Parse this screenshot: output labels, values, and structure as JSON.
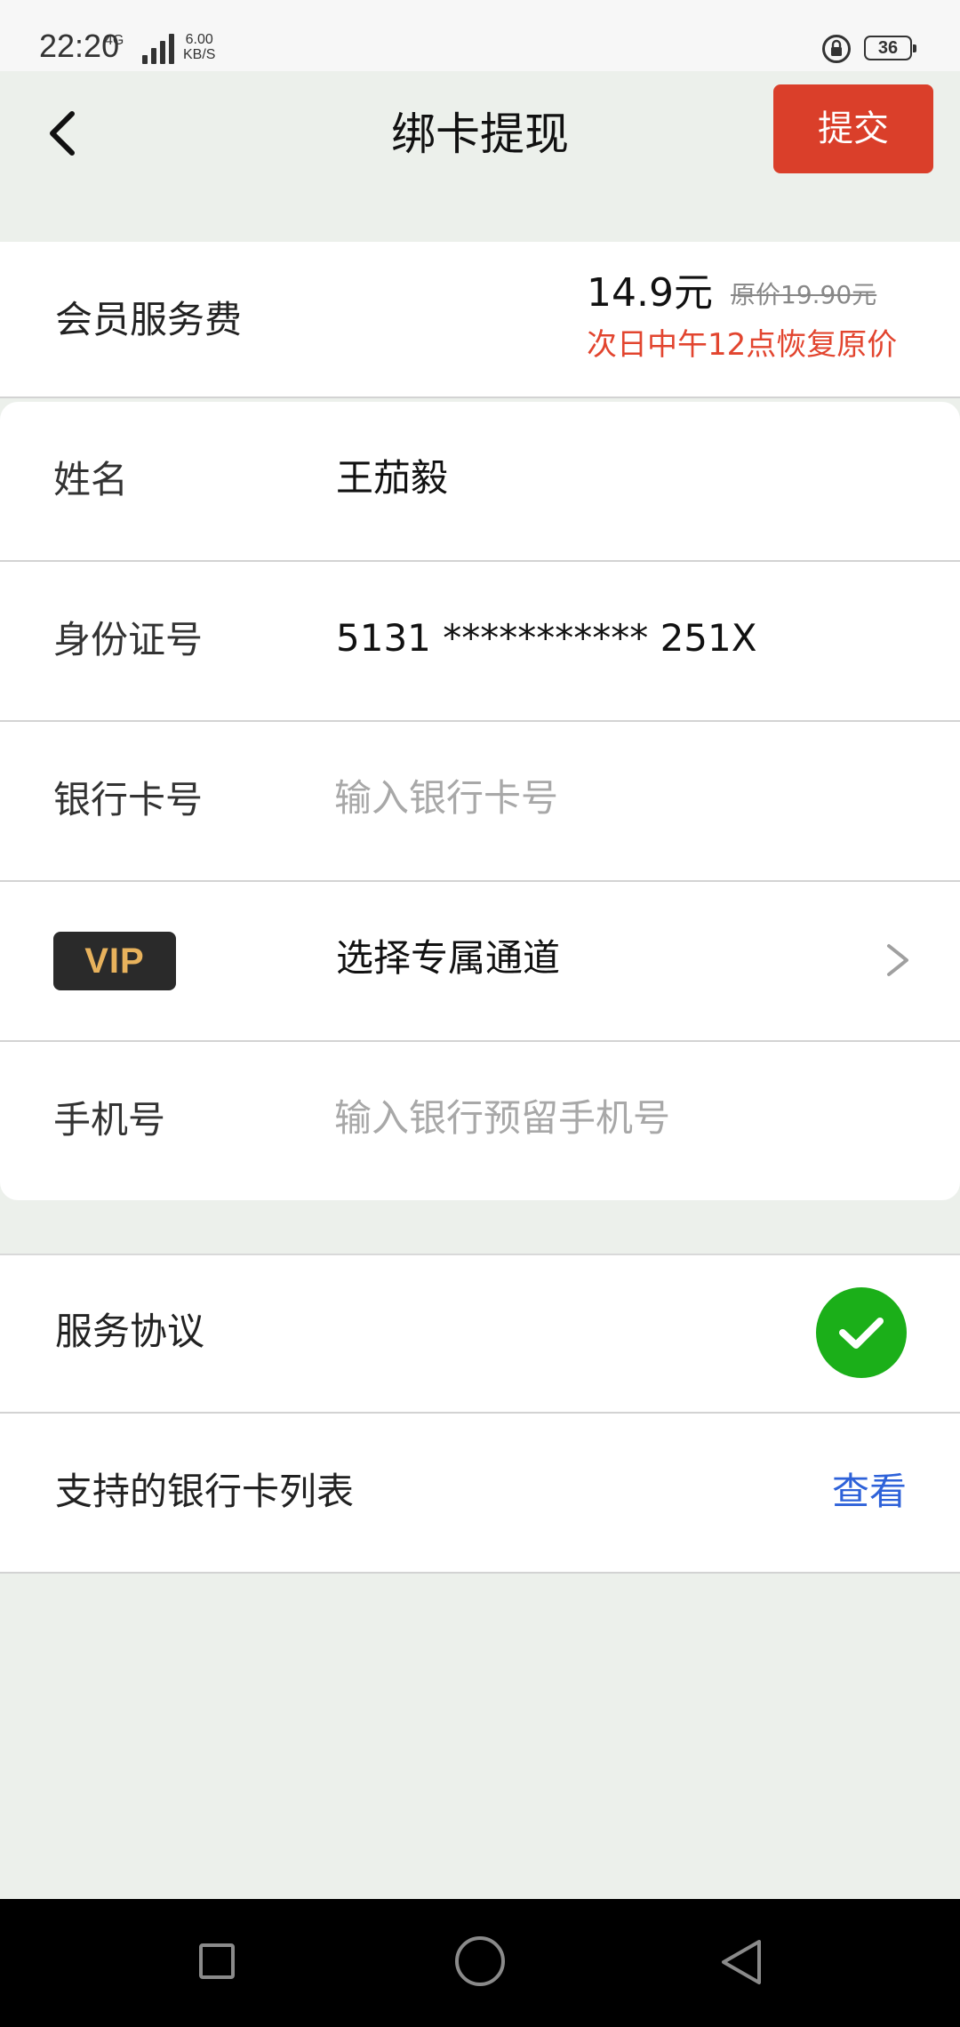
{
  "status_bar": {
    "time": "22:20",
    "network": "4G",
    "speed_value": "6.00",
    "speed_unit": "KB/S",
    "battery": "36"
  },
  "header": {
    "title": "绑卡提现",
    "submit_label": "提交"
  },
  "fee": {
    "label": "会员服务费",
    "price": "14.9元",
    "original_price": "原价19.90元",
    "notice": "次日中午12点恢复原价"
  },
  "form": {
    "name": {
      "label": "姓名",
      "value": "王茄毅"
    },
    "id_number": {
      "label": "身份证号",
      "value": "5131 *********** 251X"
    },
    "bank_card": {
      "label": "银行卡号",
      "placeholder": "输入银行卡号"
    },
    "channel": {
      "badge": "VIP",
      "value": "选择专属通道"
    },
    "phone": {
      "label": "手机号",
      "placeholder": "输入银行预留手机号"
    }
  },
  "agreement": {
    "label": "服务协议",
    "checked": true
  },
  "bank_list": {
    "label": "支持的银行卡列表",
    "link": "查看"
  },
  "colors": {
    "background": "#ECF0EB",
    "submit": "#DA3F2A",
    "notice": "#E2452F",
    "check": "#1BAF19",
    "link": "#2E62D9",
    "vip_badge_bg": "#2A2A2A",
    "vip_badge_text": "#E8B25C"
  },
  "icons": {
    "back": "chevron-left-icon",
    "channel_arrow": "chevron-right-icon",
    "agreement_check": "check-icon",
    "status_lock": "lock-rotation-icon"
  }
}
